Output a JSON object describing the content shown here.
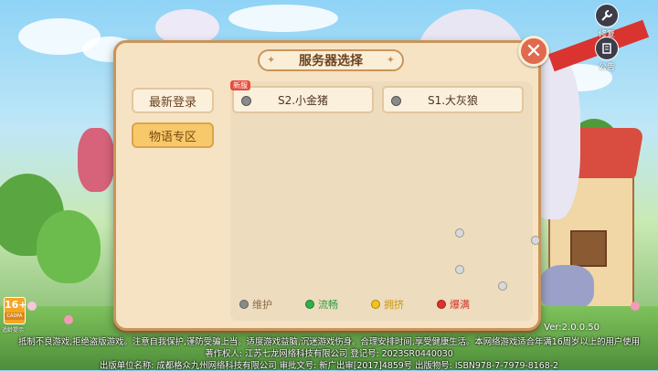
{
  "tools": {
    "repair_label": "修复",
    "notice_label": "公告"
  },
  "dialog": {
    "title": "服务器选择",
    "tabs": [
      {
        "label": "最新登录"
      },
      {
        "label": "物语专区"
      }
    ],
    "servers": [
      {
        "name": "S2.小金猪",
        "tag": "新服",
        "status": "maintenance"
      },
      {
        "name": "S1.大灰狼",
        "tag": "",
        "status": "maintenance"
      }
    ],
    "legend": [
      {
        "label": "维护",
        "color": "#8a8a8a"
      },
      {
        "label": "流畅",
        "color": "#2fb14a"
      },
      {
        "label": "拥挤",
        "color": "#f2c318"
      },
      {
        "label": "爆满",
        "color": "#e0302b"
      }
    ],
    "legend_text_colors": [
      "#8a6a4a",
      "#2f9a3e",
      "#c99a10",
      "#d2322a"
    ]
  },
  "age_rating": {
    "number": "16+",
    "caption": "CADPA",
    "note": "适龄提示"
  },
  "version": "Ver:2.0.0.50",
  "footer": [
    "抵制不良游戏,拒绝盗版游戏。注意自我保护,谨防受骗上当。适度游戏益脑,沉迷游戏伤身。合理安排时间,享受健康生活。本网络游戏适合年满16周岁以上的用户使用",
    "著作权人: 江苏七龙网络科技有限公司  登记号: 2023SR0440030",
    "出版单位名称: 成都格众九州网络科技有限公司  审批文号: 新广出审[2017]4859号  出版物号: ISBN978-7-7979-8168-2"
  ]
}
